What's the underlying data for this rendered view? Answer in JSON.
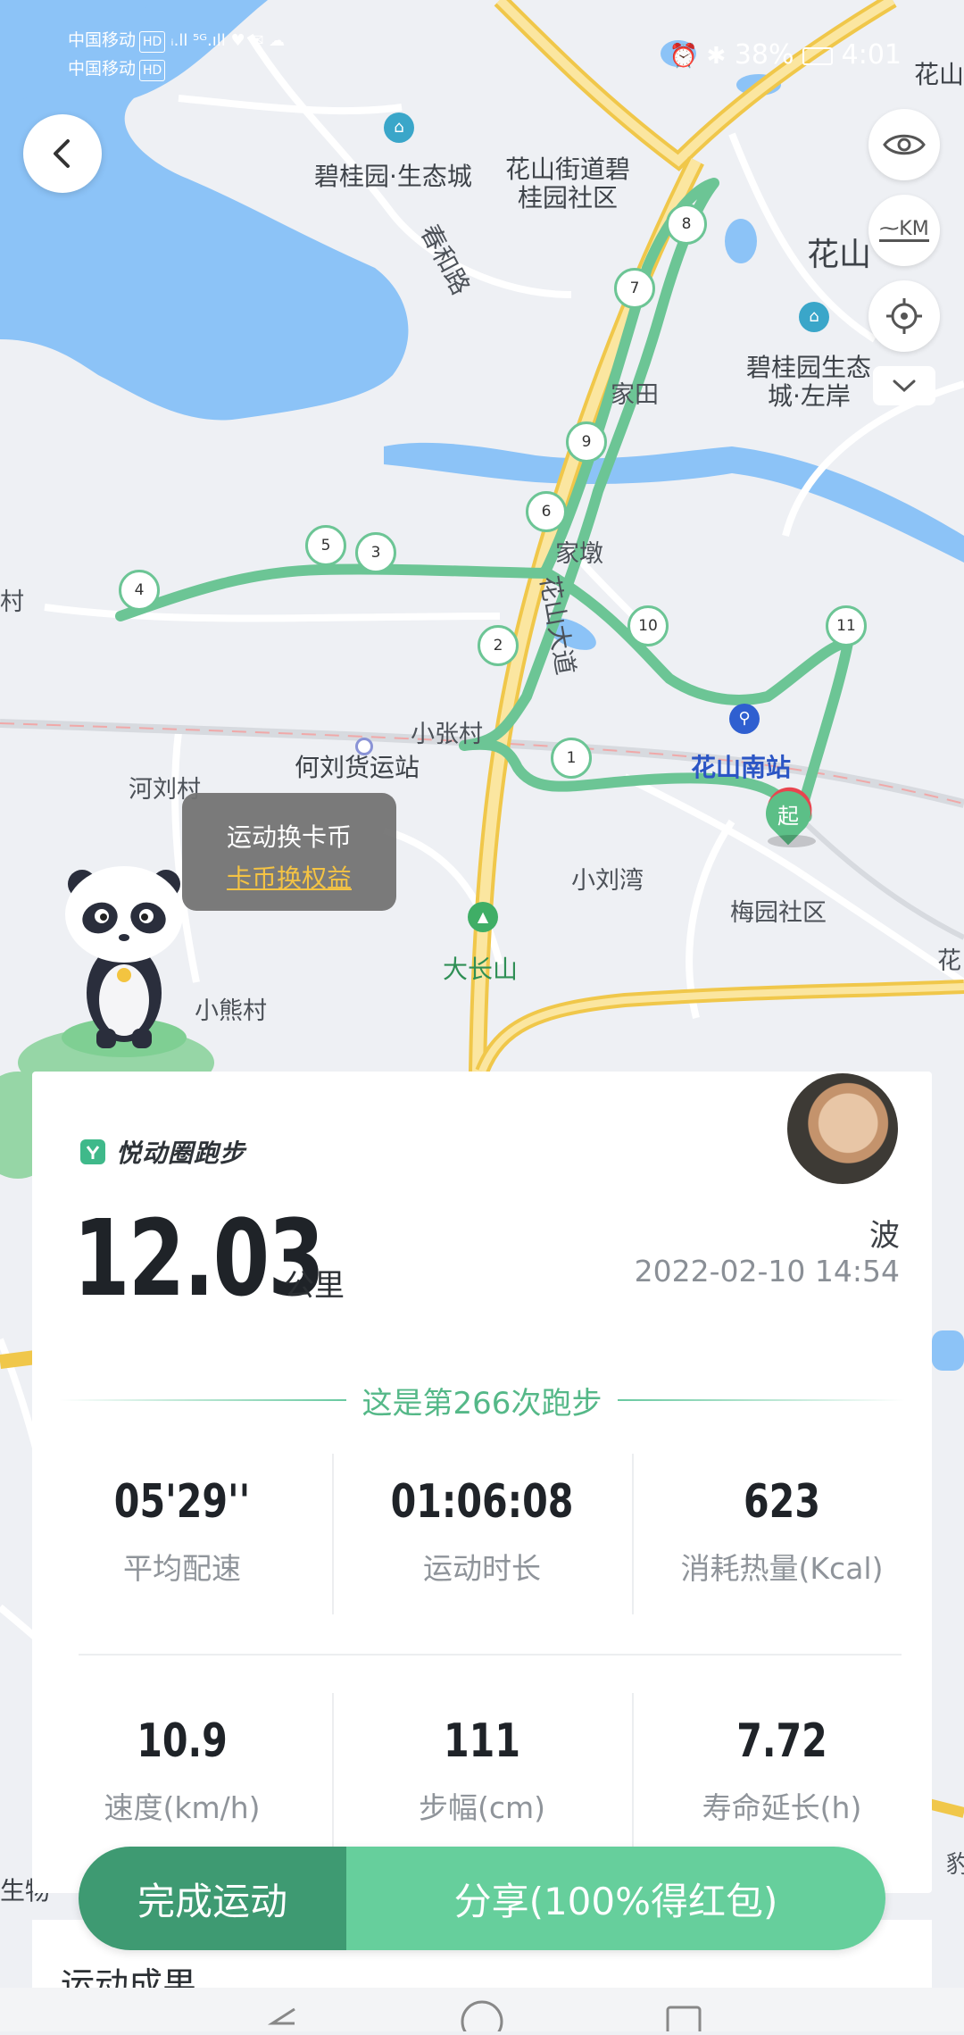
{
  "status_bar": {
    "carrier1": "中国移动",
    "carrier2": "中国移动",
    "tag1": "HD",
    "tag2": "HD",
    "battery": "38%",
    "time": "4:01"
  },
  "map": {
    "labels": {
      "biguiyuan_eco": "碧桂园·生态城",
      "huashan_street_1": "花山街道碧",
      "huashan_street_2": "桂园社区",
      "chunhe_road": "春和路",
      "huashan": "花山",
      "huashan_corner": "花山",
      "biguiyuan_zuoan_1": "碧桂园生态",
      "biguiyuan_zuoan_2": "城·左岸",
      "xjt": "家田",
      "xujiadun": "家墩",
      "huashan_ave": "花山大道",
      "xiaozhang": "小张村",
      "heliu_freight": "何刘货运站",
      "heliu_village": "河刘村",
      "huashan_south": "花山南站",
      "xiaoliuwan": "小刘湾",
      "meiyuan": "梅园社区",
      "dachangshan": "大长山",
      "xiaoxiong": "小熊村",
      "edge_hua": "花",
      "edge_cun": "村",
      "edge_bao": "豹",
      "edge_shengwu": "生物"
    },
    "markers": [
      "1",
      "2",
      "3",
      "4",
      "5",
      "6",
      "7",
      "8",
      "9",
      "10",
      "11"
    ],
    "start_marker": "起",
    "route_color": "#6cc595",
    "water_color": "#8cc3f7"
  },
  "tooltip": {
    "line1": "运动换卡币",
    "line2": "卡币换权益"
  },
  "card": {
    "brand": "悦动圈跑步",
    "distance": "12.03",
    "unit": "公里",
    "username": "波",
    "datetime": "2022-02-10 14:54",
    "run_count": "这是第266次跑步",
    "stats": [
      {
        "value": "05'29''",
        "label": "平均配速"
      },
      {
        "value": "01:06:08",
        "label": "运动时长"
      },
      {
        "value": "623",
        "label": "消耗热量(Kcal)"
      },
      {
        "value": "10.9",
        "label": "速度(km/h)"
      },
      {
        "value": "111",
        "label": "步幅(cm)"
      },
      {
        "value": "7.72",
        "label": "寿命延长(h)"
      }
    ]
  },
  "buttons": {
    "finish": "完成运动",
    "share": "分享(100%得红包)"
  },
  "section_title": "运动成果",
  "controls": {
    "km_label": "KM"
  }
}
